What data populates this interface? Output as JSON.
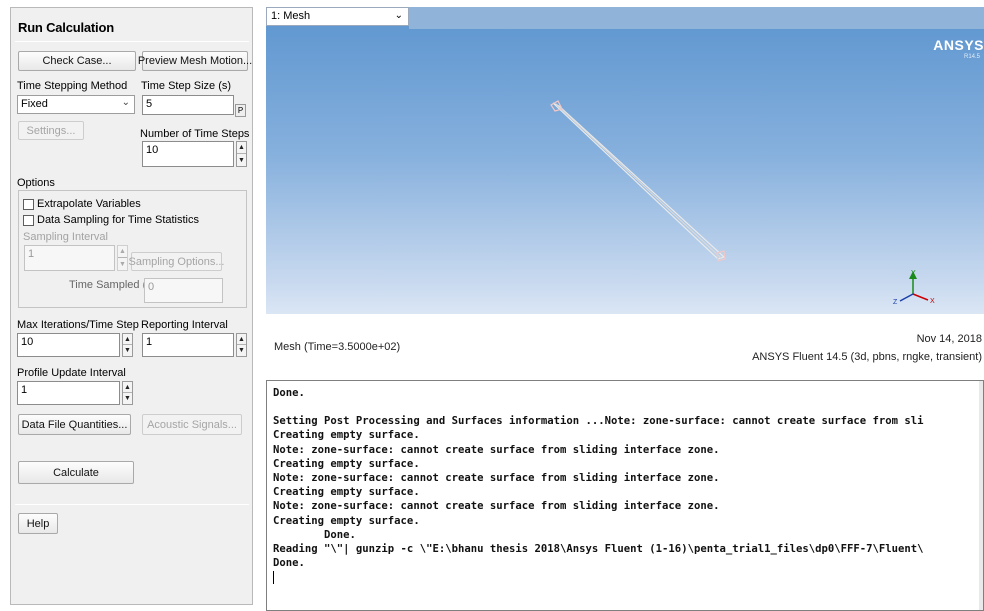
{
  "panel": {
    "title": "Run Calculation",
    "check_case": "Check Case...",
    "preview_mesh_motion": "Preview Mesh Motion...",
    "time_stepping_method_label": "Time Stepping Method",
    "time_stepping_method_value": "Fixed",
    "time_step_size_label": "Time Step Size (s)",
    "time_step_size_value": "5",
    "parameter_button": "P",
    "settings_button": "Settings...",
    "num_time_steps_label": "Number of Time Steps",
    "num_time_steps_value": "10",
    "options_label": "Options",
    "extrapolate_variables": "Extrapolate Variables",
    "data_sampling": "Data Sampling for Time Statistics",
    "sampling_interval_label": "Sampling Interval",
    "sampling_interval_value": "1",
    "sampling_options_button": "Sampling Options...",
    "time_sampled_label": "Time Sampled (s)",
    "time_sampled_value": "0",
    "max_iterations_label": "Max Iterations/Time Step",
    "max_iterations_value": "10",
    "reporting_interval_label": "Reporting Interval",
    "reporting_interval_value": "1",
    "profile_update_label": "Profile Update Interval",
    "profile_update_value": "1",
    "data_file_quantities_button": "Data File Quantities...",
    "acoustic_signals_button": "Acoustic Signals...",
    "calculate_button": "Calculate",
    "help_button": "Help"
  },
  "graphics": {
    "view_selector": "1: Mesh",
    "logo": "ANSYS",
    "logo_version": "R14.5",
    "status_left": "Mesh  (Time=3.5000e+02)",
    "date": "Nov 14, 2018",
    "solver_info": "ANSYS Fluent 14.5 (3d, pbns, rngke, transient)",
    "bg_top_color": "#5c95cf",
    "mesh_color": "#e8e8e8"
  },
  "console": {
    "lines": [
      "Done.",
      "",
      "Setting Post Processing and Surfaces information ...Note: zone-surface: cannot create surface from sli",
      "Creating empty surface.",
      "Note: zone-surface: cannot create surface from sliding interface zone.",
      "Creating empty surface.",
      "Note: zone-surface: cannot create surface from sliding interface zone.",
      "Creating empty surface.",
      "Note: zone-surface: cannot create surface from sliding interface zone.",
      "Creating empty surface.",
      "        Done.",
      "Reading \"\\\"| gunzip -c \\\"E:\\bhanu thesis 2018\\Ansys Fluent (1-16)\\penta_trial1_files\\dp0\\FFF-7\\Fluent\\",
      "Done."
    ]
  }
}
